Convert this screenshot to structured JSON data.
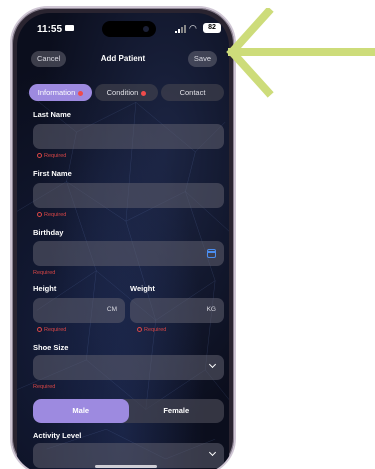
{
  "status": {
    "time": "11:55",
    "battery": "82"
  },
  "nav": {
    "cancel": "Cancel",
    "title": "Add Patient",
    "save": "Save"
  },
  "tabs": [
    {
      "label": "Information",
      "active": true,
      "has_error": true
    },
    {
      "label": "Condition",
      "active": false,
      "has_error": true
    },
    {
      "label": "Contact",
      "active": false,
      "has_error": false
    }
  ],
  "form": {
    "last_name": {
      "label": "Last Name",
      "value": "",
      "error": "Required"
    },
    "first_name": {
      "label": "First Name",
      "value": "",
      "error": "Required"
    },
    "birthday": {
      "label": "Birthday",
      "value": "",
      "error": "Required"
    },
    "height": {
      "label": "Height",
      "unit": "CM",
      "error": "Required"
    },
    "weight": {
      "label": "Weight",
      "unit": "KG",
      "error": "Required"
    },
    "shoe_size": {
      "label": "Shoe Size",
      "value": "",
      "error": "Required"
    },
    "gender": {
      "options": [
        "Male",
        "Female"
      ],
      "selected": "Male"
    },
    "activity_level": {
      "label": "Activity Level",
      "value": ""
    }
  },
  "colors": {
    "accent": "#9d8ae0",
    "error": "#d94646",
    "annotation_arrow": "#cddc7a",
    "calendar": "#4b8ef0"
  }
}
